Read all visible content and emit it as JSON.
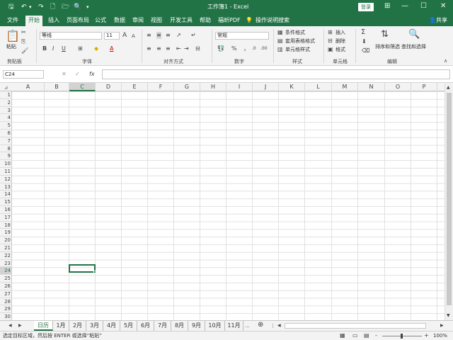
{
  "titlebar": {
    "title": "工作簿1 - Excel",
    "login_label": "登录",
    "qat": {
      "save": "🖫",
      "undo": "↶",
      "redo": "↷",
      "new": "🗋",
      "open": "🗁",
      "preview": "🔍",
      "more": "▾"
    },
    "controls": {
      "ribbon_opts": "⊞",
      "minimize": "—",
      "maximize": "☐",
      "close": "✕"
    }
  },
  "tabs": [
    "文件",
    "开始",
    "插入",
    "页面布局",
    "公式",
    "数据",
    "审阅",
    "视图",
    "开发工具",
    "帮助",
    "福昕PDF"
  ],
  "tell_me": "操作说明搜索",
  "share": "共享",
  "ribbon": {
    "clipboard": {
      "paste": "粘贴",
      "label": "剪贴板"
    },
    "font": {
      "name": "等线",
      "size": "11",
      "grow": "A",
      "shrink": "A",
      "bold": "B",
      "italic": "I",
      "underline": "U",
      "label": "字体"
    },
    "alignment": {
      "label": "对齐方式"
    },
    "number": {
      "format": "常规",
      "pct": "%",
      "comma": "，",
      "label": "数字"
    },
    "styles": {
      "conditional": "条件格式",
      "table": "套用表格格式",
      "cell": "单元格样式",
      "label": "样式"
    },
    "cells": {
      "insert": "插入",
      "delete": "删除",
      "format": "格式",
      "label": "单元格"
    },
    "editing": {
      "sum": "Σ",
      "sort": "排序和筛选",
      "find": "查找和选择",
      "label": "编辑"
    }
  },
  "formula_bar": {
    "name_box": "C24",
    "cancel": "✕",
    "enter": "✓",
    "fx": "fx",
    "value": ""
  },
  "columns": [
    "A",
    "B",
    "C",
    "D",
    "E",
    "F",
    "G",
    "H",
    "I",
    "J",
    "K",
    "L",
    "M",
    "N",
    "O",
    "P"
  ],
  "rows": [
    "1",
    "2",
    "3",
    "4",
    "5",
    "6",
    "7",
    "8",
    "9",
    "10",
    "11",
    "12",
    "13",
    "14",
    "15",
    "16",
    "17",
    "18",
    "19",
    "20",
    "21",
    "22",
    "23",
    "24",
    "25",
    "26",
    "27",
    "28",
    "29",
    "30"
  ],
  "selected_cell": {
    "col": "C",
    "row": "24"
  },
  "sheets": [
    "日历",
    "1月",
    "2月",
    "3月",
    "4月",
    "5月",
    "6月",
    "7月",
    "8月",
    "9月",
    "10月",
    "11月"
  ],
  "active_sheet": "日历",
  "sheet_more": "...",
  "status": {
    "message": "选定目标区域，然后按 ENTER 或选择“粘贴”",
    "zoom": "100%",
    "zoom_minus": "-",
    "zoom_plus": "+"
  }
}
